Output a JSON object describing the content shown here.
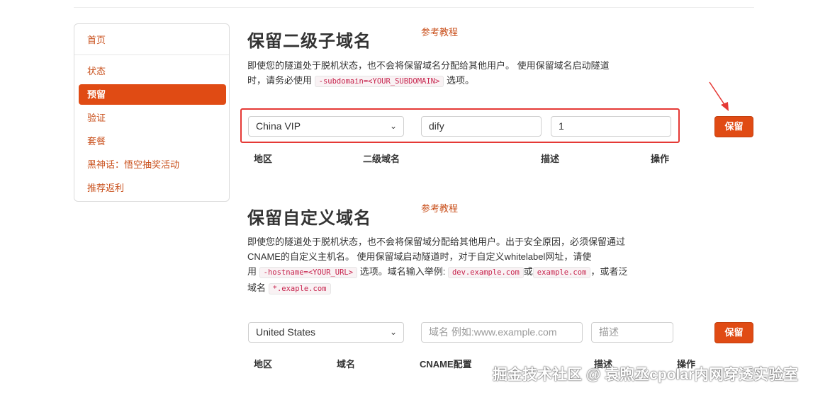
{
  "sidebar": {
    "items": [
      {
        "label": "首页"
      },
      {
        "label": "状态"
      },
      {
        "label": "预留"
      },
      {
        "label": "验证"
      },
      {
        "label": "套餐"
      },
      {
        "label": "黑神话：悟空抽奖活动"
      },
      {
        "label": "推荐返利"
      }
    ]
  },
  "subdomain": {
    "title": "保留二级子域名",
    "ref": "参考教程",
    "desc1": "即使您的隧道处于脱机状态，也不会将保留域名分配给其他用户。 使用保留域名启动隧道",
    "desc2a": "时，请务必使用",
    "code": "-subdomain=<YOUR_SUBDOMAIN>",
    "desc2b": "选项。",
    "region": "China VIP",
    "name_value": "dify",
    "desc_value": "1",
    "button": "保留",
    "headers": {
      "region": "地区",
      "name": "二级域名",
      "desc": "描述",
      "action": "操作"
    }
  },
  "custom": {
    "title": "保留自定义域名",
    "ref": "参考教程",
    "line1": "即使您的隧道处于脱机状态，也不会将保留域分配给其他用户。出于安全原因，必须保留通过",
    "line2": "CNAME的自定义主机名。 使用保留域启动隧道时，对于自定义whitelabel网址，请使",
    "line3a": "用",
    "code1": "-hostname=<YOUR_URL>",
    "line3b": "选项。域名输入举例:",
    "code2": "dev.example.com",
    "line3c": "或",
    "code3": "example.com",
    "line3d": "，或者泛",
    "line4a": "域名",
    "code4": "*.exaple.com",
    "region": "United States",
    "domain_placeholder": "域名 例如:www.example.com",
    "desc_placeholder": "描述",
    "button": "保留",
    "headers": {
      "region": "地区",
      "domain": "域名",
      "cname": "CNAME配置",
      "desc": "描述",
      "action": "操作"
    }
  },
  "watermark": "掘金技术社区 @ 袁煦丞cpolar内网穿透实验室",
  "colors": {
    "accent": "#e04b14",
    "link": "#c9501c",
    "highlight": "#e53935"
  }
}
